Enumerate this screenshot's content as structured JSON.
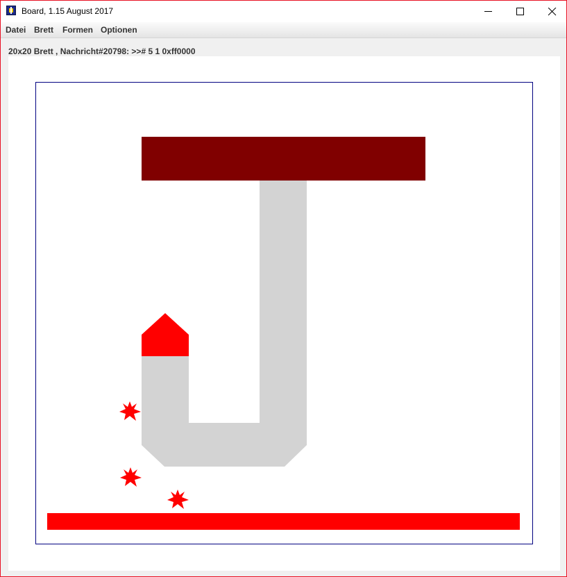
{
  "window": {
    "title": "Board, 1.15 August 2017"
  },
  "menu": {
    "items": [
      "Datei",
      "Brett",
      "Formen",
      "Optionen"
    ]
  },
  "status": {
    "text": "20x20 Brett , Nachricht#20798: >># 5 1 0xff0000"
  },
  "board": {
    "size": "20x20",
    "border_color": "#000080",
    "shapes": [
      {
        "name": "top-bar",
        "kind": "rectangle",
        "color": "#800000"
      },
      {
        "name": "j-body",
        "kind": "polygon",
        "color": "#d3d3d3"
      },
      {
        "name": "house-top",
        "kind": "pentagon",
        "color": "#ff0000"
      },
      {
        "name": "bottom-bar",
        "kind": "rectangle",
        "color": "#ff0000"
      },
      {
        "name": "star-1",
        "kind": "star",
        "color": "#ff0000"
      },
      {
        "name": "star-2",
        "kind": "star",
        "color": "#ff0000"
      },
      {
        "name": "star-3",
        "kind": "star",
        "color": "#ff0000"
      }
    ]
  }
}
